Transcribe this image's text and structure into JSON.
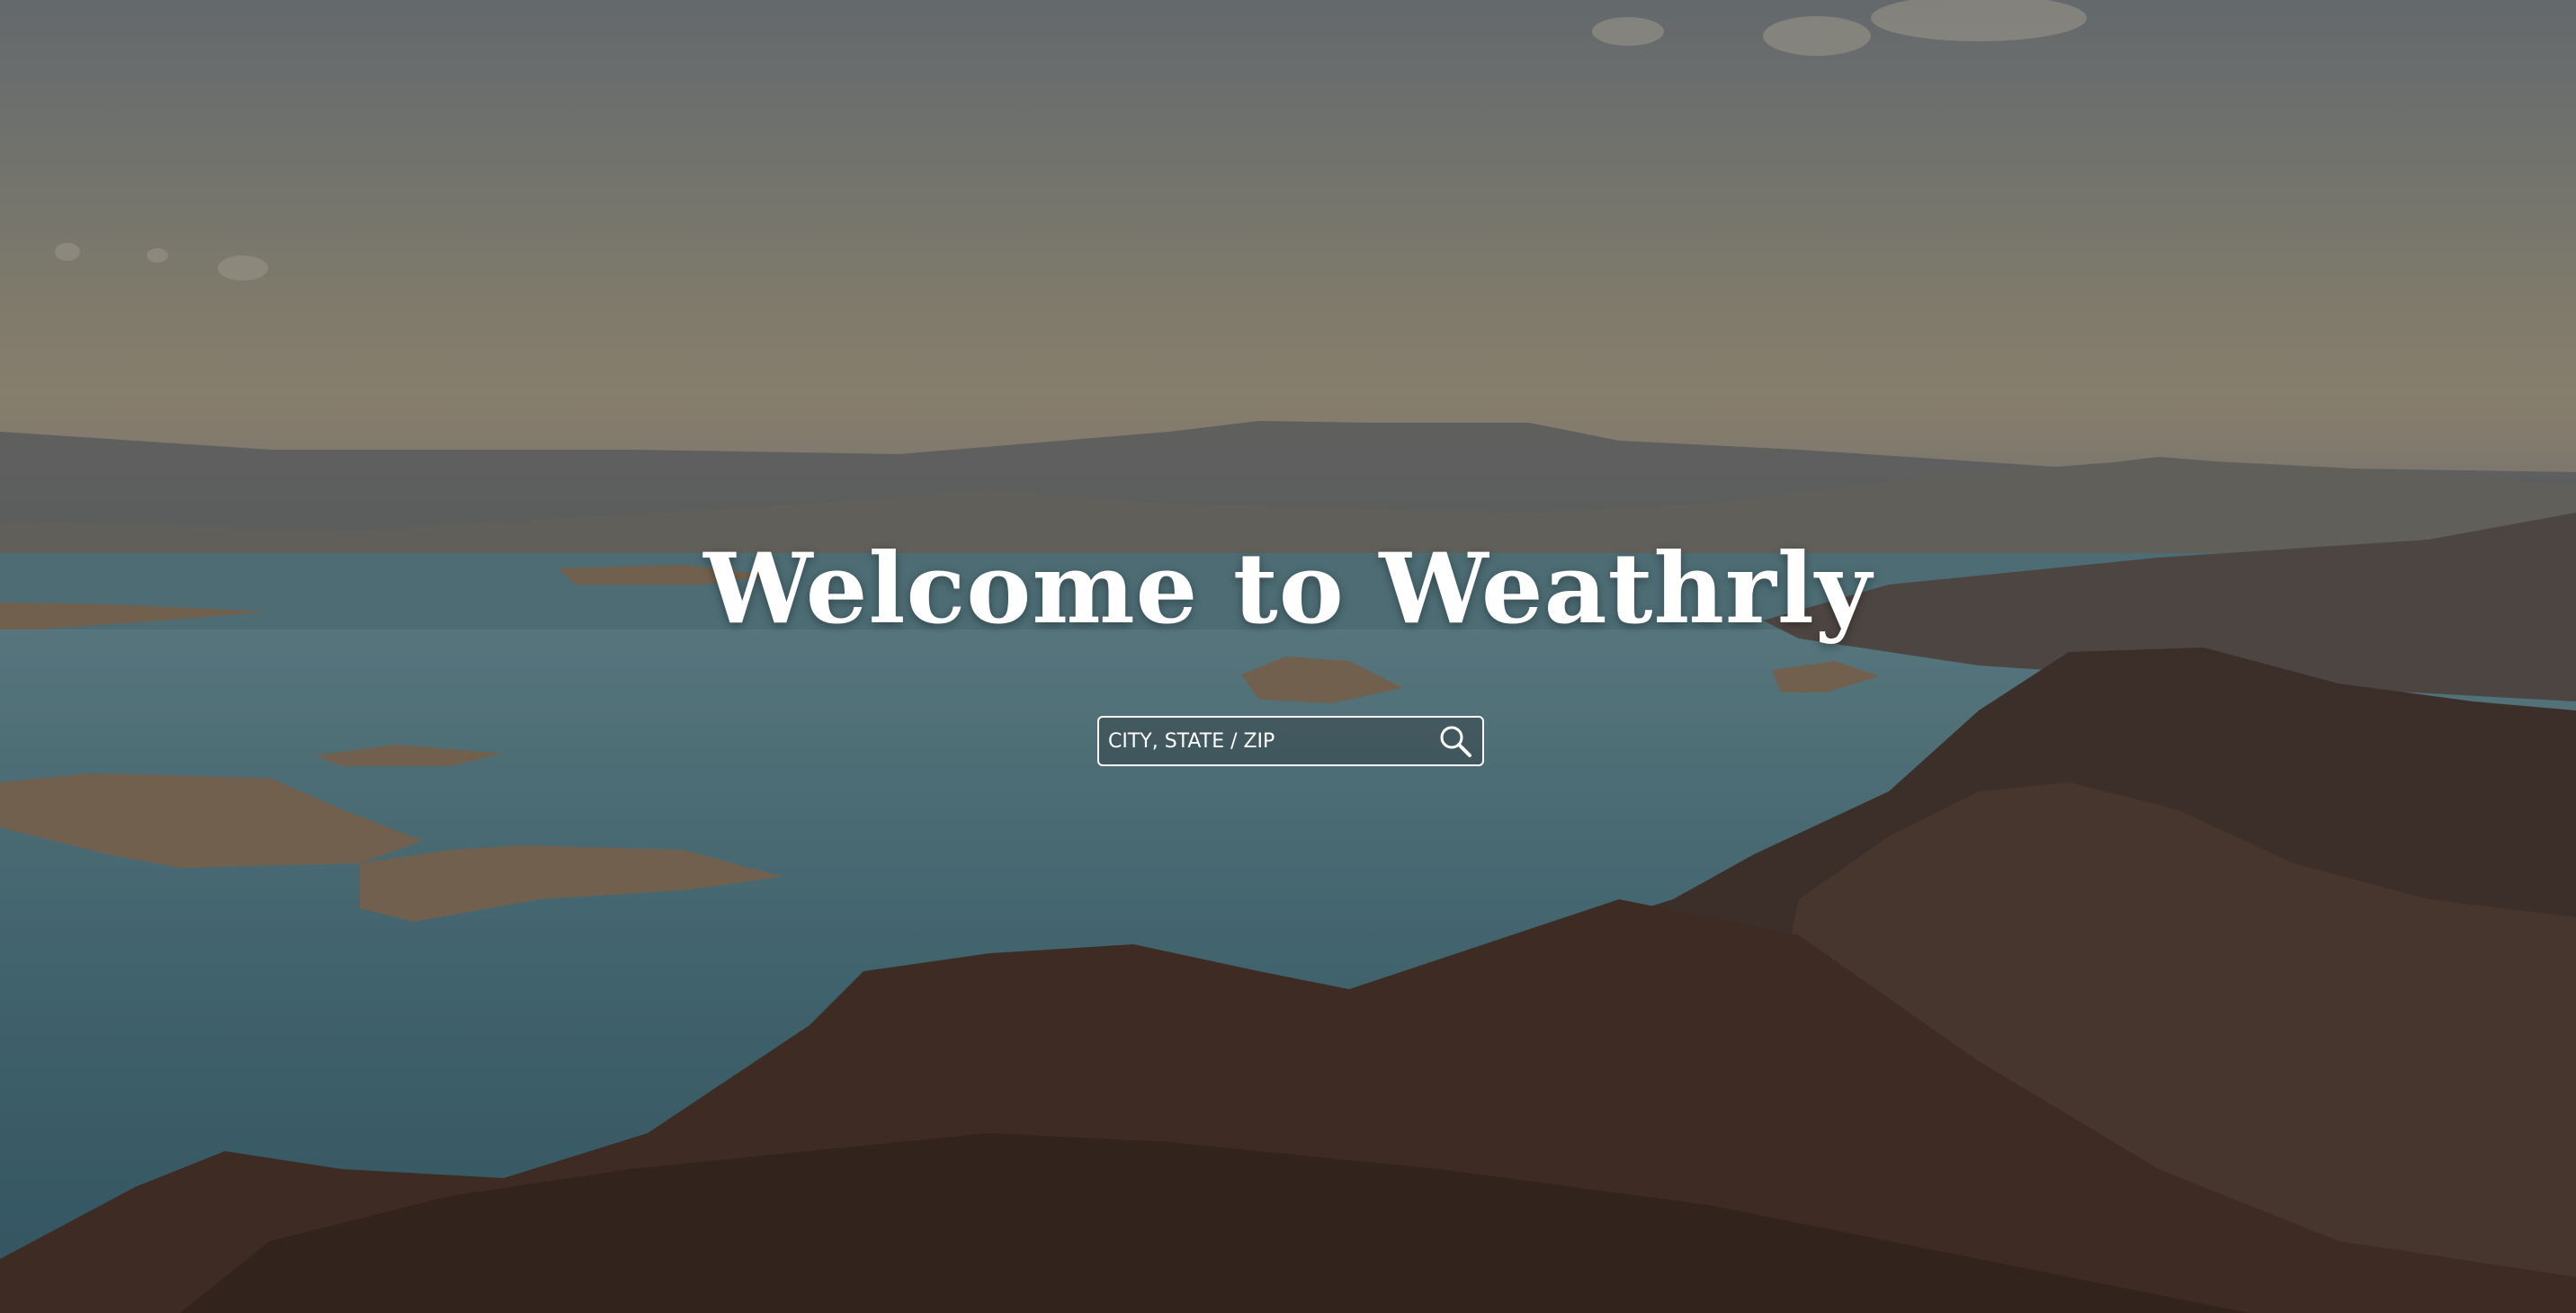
{
  "hero": {
    "title": "Welcome to Weathrly",
    "background_icon": "landscape-photo"
  },
  "search": {
    "placeholder": "CITY, STATE / ZIP",
    "value": "",
    "button_icon": "search-icon"
  },
  "colors": {
    "text": "#ffffff",
    "input_border": "#ffffff"
  }
}
